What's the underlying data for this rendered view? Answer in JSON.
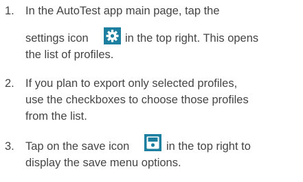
{
  "steps": [
    {
      "number": "1.",
      "lines": [
        "In the AutoTest app main page, tap the",
        "settings icon",
        "in the top right. This opens",
        "the list of profiles."
      ],
      "icon": "gear-icon",
      "icon_color": "#1c7fa0"
    },
    {
      "number": "2.",
      "lines": [
        "If you plan to export only selected profiles,",
        "use the checkboxes to choose those profiles",
        "from the list."
      ]
    },
    {
      "number": "3.",
      "lines": [
        "Tap on the save icon",
        "in the top right to",
        "display the save menu options."
      ],
      "icon": "save-icon",
      "icon_color": "#1c7fa0"
    }
  ]
}
